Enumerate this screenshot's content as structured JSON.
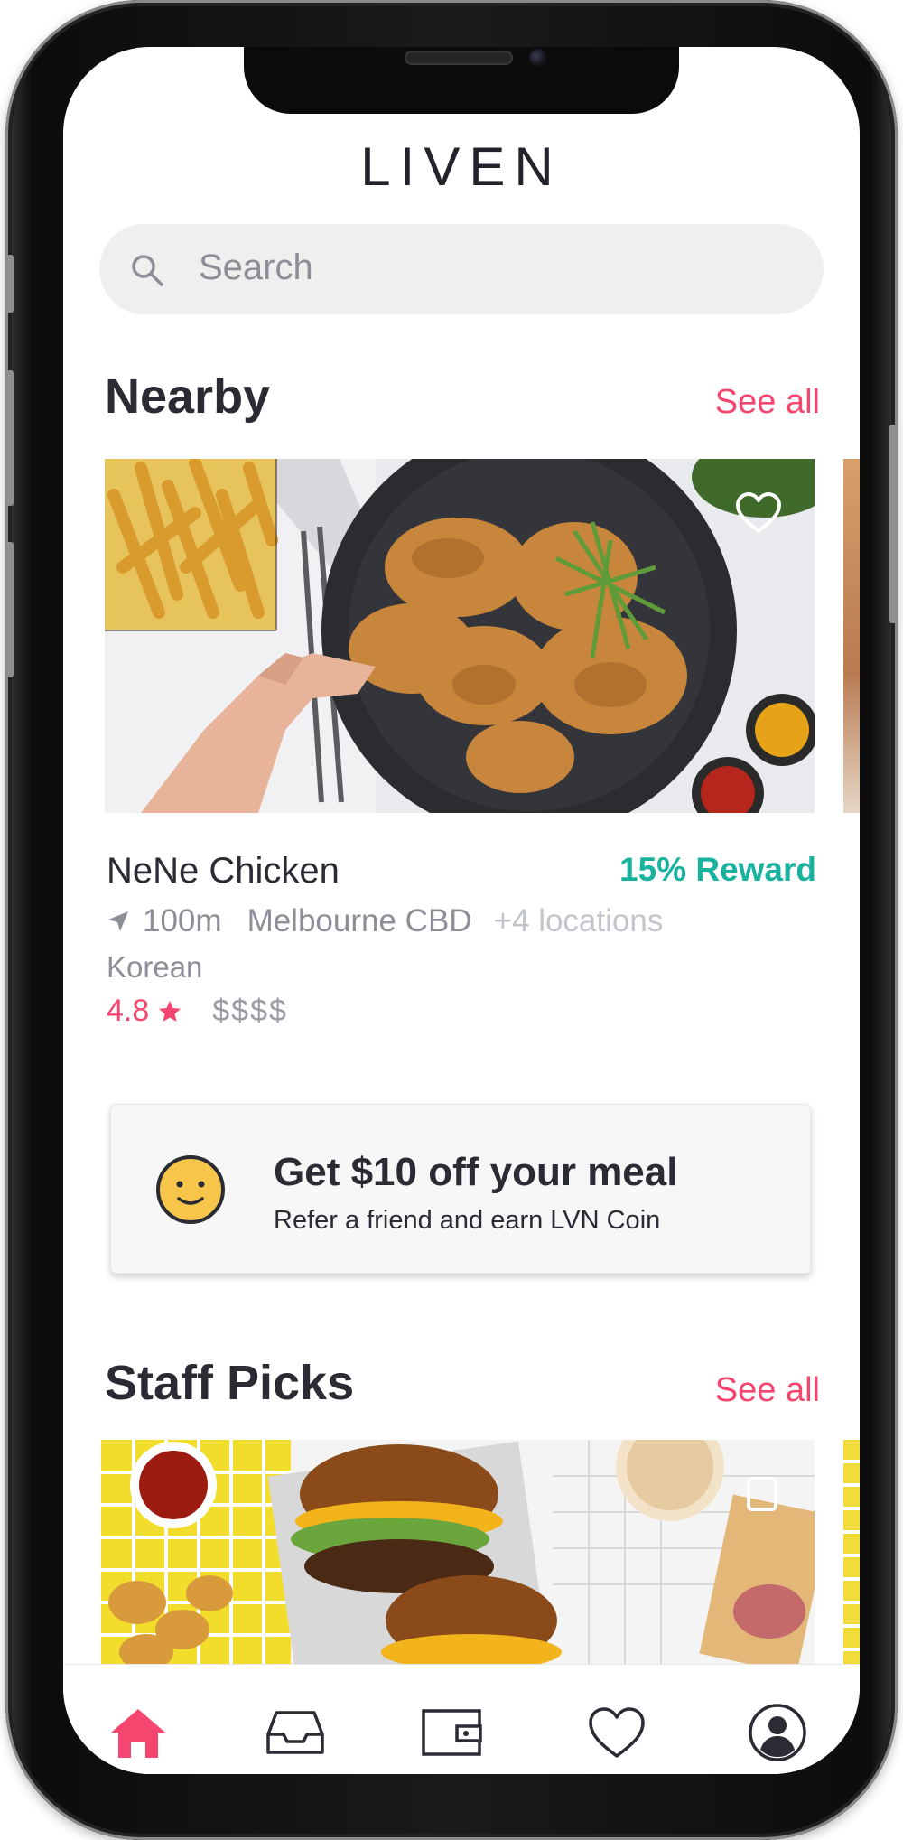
{
  "app": {
    "logo_text": "LIVEN"
  },
  "search": {
    "placeholder": "Search"
  },
  "nearby": {
    "title": "Nearby",
    "see_all_label": "See all",
    "restaurant": {
      "name": "NeNe Chicken",
      "reward": "15% Reward",
      "distance": "100m",
      "location": "Melbourne CBD",
      "more_locations": "+4 locations",
      "cuisine": "Korean",
      "rating": "4.8",
      "price": "$$$$"
    }
  },
  "promo": {
    "title": "Get $10 off your meal",
    "subtitle": "Refer a friend and earn LVN Coin",
    "icon": "smiley-icon"
  },
  "staff_picks": {
    "title": "Staff Picks",
    "see_all_label": "See all"
  },
  "tabbar": {
    "items": [
      {
        "icon": "home-icon",
        "active": true
      },
      {
        "icon": "inbox-icon",
        "active": false
      },
      {
        "icon": "wallet-icon",
        "active": false
      },
      {
        "icon": "heart-icon",
        "active": false
      },
      {
        "icon": "profile-icon",
        "active": false
      }
    ]
  },
  "colors": {
    "accent": "#f5466f",
    "reward": "#17b39e",
    "text_primary": "#2a2b33",
    "text_secondary": "#8d8f97"
  }
}
